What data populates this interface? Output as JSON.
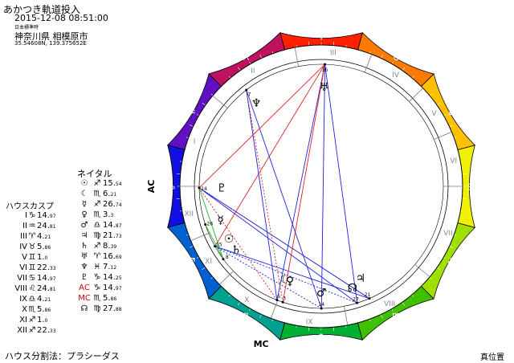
{
  "header": {
    "title": "あかつき軌道投入",
    "datetime": "2015-12-08 08:51:00",
    "timezone": "日本標準時",
    "place": "神奈川県 相模原市",
    "coords": "35.54608N, 139.375652E"
  },
  "natal": {
    "heading": "ネイタル",
    "items": [
      {
        "symbol": "☉",
        "color": "#000000",
        "sign": "♐",
        "deg": "15.",
        "min": "54"
      },
      {
        "symbol": "☾",
        "color": "#000000",
        "sign": "♏",
        "deg": "6.",
        "min": "21"
      },
      {
        "symbol": "☿",
        "color": "#000000",
        "sign": "♐",
        "deg": "26.",
        "min": "74"
      },
      {
        "symbol": "♀",
        "color": "#000000",
        "sign": "♏",
        "deg": "3.",
        "min": "3"
      },
      {
        "symbol": "♂",
        "color": "#000000",
        "sign": "♎",
        "deg": "14.",
        "min": "87"
      },
      {
        "symbol": "♃",
        "color": "#000000",
        "sign": "♍",
        "deg": "21.",
        "min": "73"
      },
      {
        "symbol": "♄",
        "color": "#000000",
        "sign": "♐",
        "deg": "8.",
        "min": "39"
      },
      {
        "symbol": "♅",
        "color": "#000000",
        "sign": "♈",
        "deg": "16.",
        "min": "69"
      },
      {
        "symbol": "♆",
        "color": "#000000",
        "sign": "♓",
        "deg": "7.",
        "min": "12"
      },
      {
        "symbol": "♇",
        "color": "#000000",
        "sign": "♑",
        "deg": "14.",
        "min": "25"
      },
      {
        "symbol": "AC",
        "color": "#cc0000",
        "sign": "♑",
        "deg": "14.",
        "min": "97"
      },
      {
        "symbol": "MC",
        "color": "#cc0000",
        "sign": "♏",
        "deg": "5.",
        "min": "86"
      },
      {
        "symbol": "☊",
        "color": "#000000",
        "sign": "♍",
        "deg": "27.",
        "min": "88"
      }
    ]
  },
  "houses": {
    "heading": "ハウスカスプ",
    "items": [
      {
        "num": "I",
        "sign": "♑",
        "deg": "14.",
        "min": "97"
      },
      {
        "num": "II",
        "sign": "♒",
        "deg": "24.",
        "min": "81"
      },
      {
        "num": "III",
        "sign": "♈",
        "deg": "4.",
        "min": "21"
      },
      {
        "num": "IV",
        "sign": "♉",
        "deg": "5.",
        "min": "86"
      },
      {
        "num": "V",
        "sign": "♊",
        "deg": "1.",
        "min": "0"
      },
      {
        "num": "VI",
        "sign": "♊",
        "deg": "22.",
        "min": "33"
      },
      {
        "num": "VII",
        "sign": "♋",
        "deg": "14.",
        "min": "97"
      },
      {
        "num": "VIII",
        "sign": "♌",
        "deg": "24.",
        "min": "81"
      },
      {
        "num": "IX",
        "sign": "♎",
        "deg": "4.",
        "min": "21"
      },
      {
        "num": "X",
        "sign": "♏",
        "deg": "5.",
        "min": "86"
      },
      {
        "num": "XI",
        "sign": "♐",
        "deg": "1.",
        "min": "0"
      },
      {
        "num": "XII",
        "sign": "♐",
        "deg": "22.",
        "min": "33"
      }
    ]
  },
  "footer": {
    "method": "ハウス分割法：プラシーダス",
    "truepos": "真位置"
  },
  "wheel": {
    "zodiac_glyphs": [
      "♈",
      "♉",
      "♊",
      "♋",
      "♌",
      "♍",
      "♎",
      "♏",
      "♐",
      "♑",
      "♒",
      "♓"
    ],
    "zodiac_colors": [
      "#ff2000",
      "#ff7a00",
      "#ffc000",
      "#f0f000",
      "#a0e000",
      "#40c000",
      "#00b030",
      "#00a090",
      "#0060d0",
      "#1010e0",
      "#6010c0",
      "#c01060"
    ],
    "house_numerals": [
      "I",
      "II",
      "III",
      "IV",
      "V",
      "VI",
      "VII",
      "VIII",
      "IX",
      "X",
      "XI",
      "XII"
    ],
    "asc_longitude": 284.97,
    "ac_label": "AC",
    "mc_label": "MC",
    "cusps": [
      284.97,
      324.81,
      4.21,
      35.86,
      61.0,
      82.33,
      104.97,
      144.81,
      184.21,
      215.86,
      241.0,
      262.33
    ],
    "planets": [
      {
        "glyph": "☉",
        "lon": 255.54,
        "deg": "15"
      },
      {
        "glyph": "☾",
        "lon": 216.21,
        "deg": "6"
      },
      {
        "glyph": "☿",
        "lon": 266.74,
        "deg": "26"
      },
      {
        "glyph": "♀",
        "lon": 213.3,
        "deg": "3"
      },
      {
        "glyph": "♂",
        "lon": 194.87,
        "deg": "14"
      },
      {
        "glyph": "♃",
        "lon": 171.73,
        "deg": "21"
      },
      {
        "glyph": "♄",
        "lon": 248.39,
        "deg": "8"
      },
      {
        "glyph": "♅",
        "lon": 16.69,
        "deg": "16"
      },
      {
        "glyph": "♆",
        "lon": 337.12,
        "deg": "7"
      },
      {
        "glyph": "♇",
        "lon": 284.25,
        "deg": "14"
      },
      {
        "glyph": "☊",
        "lon": 177.88,
        "deg": "27"
      }
    ],
    "aspects": [
      {
        "a": 0,
        "b": 5,
        "color": "#2020e0",
        "style": "solid"
      },
      {
        "a": 0,
        "b": 7,
        "color": "#e02020",
        "style": "solid"
      },
      {
        "a": 0,
        "b": 4,
        "color": "#2020e0",
        "style": "dotted"
      },
      {
        "a": 1,
        "b": 7,
        "color": "#2020e0",
        "style": "solid"
      },
      {
        "a": 1,
        "b": 8,
        "color": "#2020e0",
        "style": "solid"
      },
      {
        "a": 1,
        "b": 9,
        "color": "#e02020",
        "style": "dotted"
      },
      {
        "a": 3,
        "b": 8,
        "color": "#e02020",
        "style": "dotted"
      },
      {
        "a": 3,
        "b": 7,
        "color": "#e02020",
        "style": "solid"
      },
      {
        "a": 4,
        "b": 8,
        "color": "#2020e0",
        "style": "solid"
      },
      {
        "a": 4,
        "b": 7,
        "color": "#2020e0",
        "style": "solid"
      },
      {
        "a": 5,
        "b": 9,
        "color": "#e02020",
        "style": "dotted"
      },
      {
        "a": 9,
        "b": 5,
        "color": "#2020e0",
        "style": "solid"
      },
      {
        "a": 9,
        "b": 7,
        "color": "#e02020",
        "style": "solid"
      },
      {
        "a": 2,
        "b": 6,
        "color": "#20b020",
        "style": "solid"
      },
      {
        "a": 6,
        "b": 9,
        "color": "#20b020",
        "style": "solid"
      },
      {
        "a": 10,
        "b": 7,
        "color": "#2020e0",
        "style": "solid"
      },
      {
        "a": 10,
        "b": 9,
        "color": "#2020e0",
        "style": "solid"
      },
      {
        "a": 0,
        "b": 10,
        "color": "#2020e0",
        "style": "dotted"
      }
    ]
  }
}
